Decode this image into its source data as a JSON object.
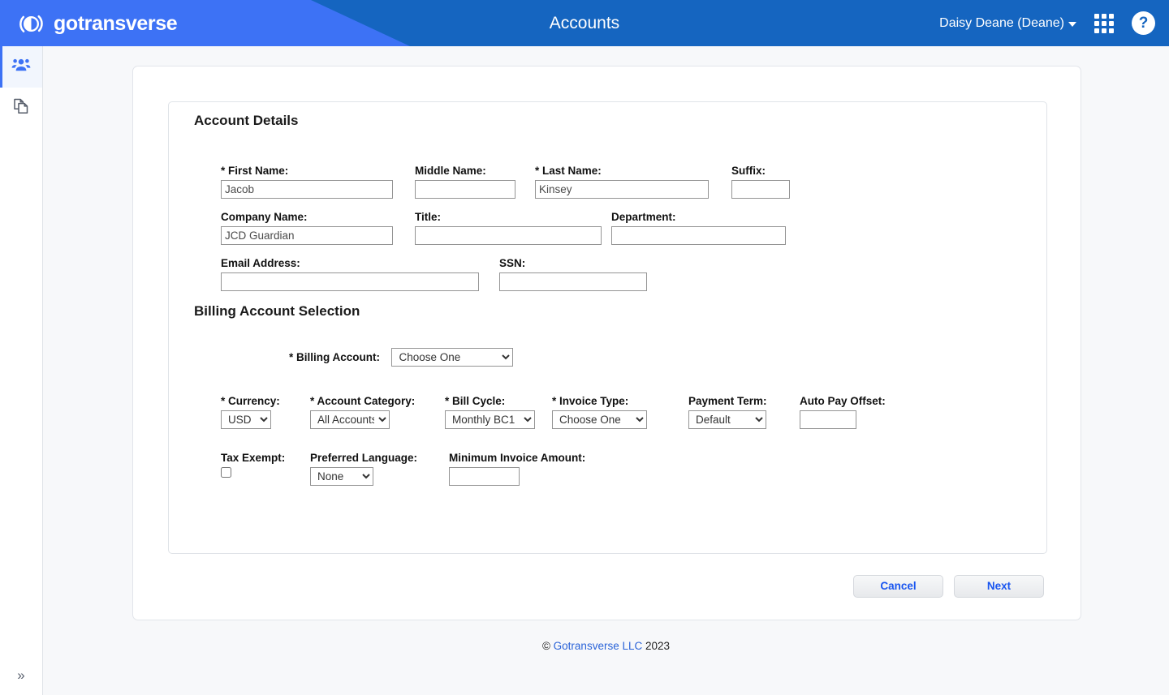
{
  "header": {
    "brand_name": "gotransverse",
    "brand_logo_icon": "gotransverse-circle-logo",
    "title": "Accounts",
    "user_menu_label": "Daisy Deane (Deane)",
    "caret_icon": "chevron-down-icon",
    "apps_icon": "apps-grid-icon",
    "help_icon": "question-mark-icon",
    "help_label": "?",
    "accent_primary": "#3d72f5",
    "accent_dark": "#1565c0"
  },
  "sidebar": {
    "items": [
      {
        "icon": "people-group-icon",
        "name": "accounts",
        "active": true
      },
      {
        "icon": "copy-documents-icon",
        "name": "products",
        "active": false
      }
    ],
    "expand_icon": "chevrons-right-icon",
    "expand_glyph": "»"
  },
  "main": {
    "account_details_title": "Account Details",
    "billing_section_title": "Billing Account Selection",
    "fields": {
      "first_name": {
        "label": "First Name:",
        "required_mark": "*",
        "value": "Jacob",
        "placeholder": ""
      },
      "middle_name": {
        "label": "Middle Name:",
        "required_mark": "",
        "value": "",
        "placeholder": ""
      },
      "last_name": {
        "label": "Last Name:",
        "required_mark": "*",
        "value": "Kinsey",
        "placeholder": ""
      },
      "suffix": {
        "label": "Suffix:",
        "required_mark": "",
        "value": "",
        "placeholder": ""
      },
      "company_name": {
        "label": "Company Name:",
        "required_mark": "",
        "value": "JCD Guardian",
        "placeholder": ""
      },
      "title": {
        "label": "Title:",
        "required_mark": "",
        "value": "",
        "placeholder": ""
      },
      "department": {
        "label": "Department:",
        "required_mark": "",
        "value": "",
        "placeholder": ""
      },
      "email_address": {
        "label": "Email Address:",
        "required_mark": "",
        "value": "",
        "placeholder": ""
      },
      "ssn": {
        "label": "SSN:",
        "required_mark": "",
        "value": "",
        "placeholder": ""
      },
      "billing_account": {
        "label": "Billing Account:",
        "required_mark": "*",
        "selected": "Choose One"
      },
      "currency": {
        "label": "Currency:",
        "required_mark": "*",
        "selected": "USD"
      },
      "account_category": {
        "label": "Account Category:",
        "required_mark": "*",
        "selected": "All Accounts"
      },
      "bill_cycle": {
        "label": "Bill Cycle:",
        "required_mark": "*",
        "selected": "Monthly BC1"
      },
      "invoice_type": {
        "label": "Invoice Type:",
        "required_mark": "*",
        "selected": "Choose One"
      },
      "payment_term": {
        "label": "Payment Term:",
        "required_mark": "",
        "selected": "Default"
      },
      "auto_pay_offset": {
        "label": "Auto Pay Offset:",
        "required_mark": "",
        "value": "",
        "placeholder": ""
      },
      "tax_exempt": {
        "label": "Tax Exempt:",
        "required_mark": "",
        "checked": false
      },
      "preferred_language": {
        "label": "Preferred Language:",
        "required_mark": "",
        "selected": "None"
      },
      "minimum_invoice_amount": {
        "label": "Minimum Invoice Amount:",
        "required_mark": "",
        "value": "",
        "placeholder": ""
      }
    },
    "buttons": {
      "cancel_label": "Cancel",
      "next_label": "Next"
    }
  },
  "footer": {
    "copyright_symbol": "©",
    "company_link": "Gotransverse LLC",
    "year": "2023"
  }
}
